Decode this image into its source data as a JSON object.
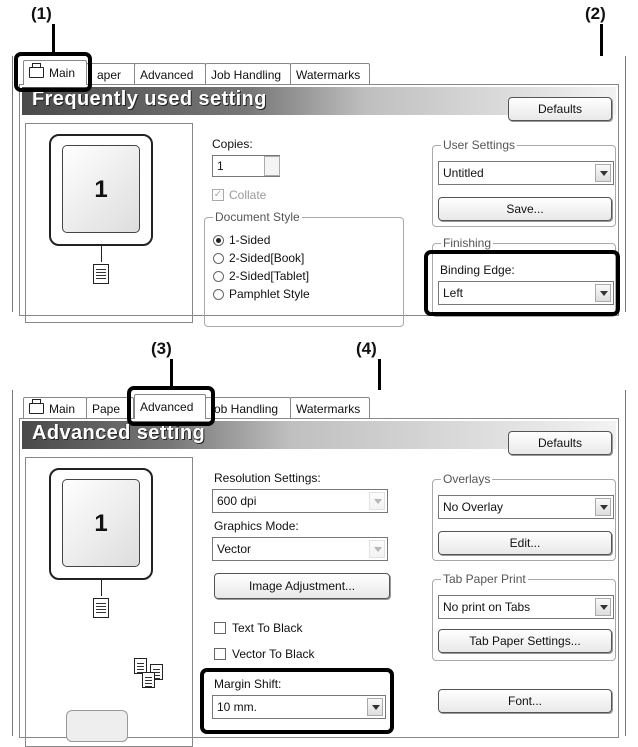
{
  "callouts": {
    "c1": "(1)",
    "c2": "(2)",
    "c3": "(3)",
    "c4": "(4)"
  },
  "tabs": [
    "Main",
    "Paper",
    "Advanced",
    "Job Handling",
    "Watermarks"
  ],
  "tabs_top_shown": {
    "main": "Main",
    "paper": "aper",
    "advanced": "Advanced",
    "job": "Job Handling",
    "watermarks": "Watermarks"
  },
  "tabs_bottom_shown": {
    "main": "Main",
    "paper": "Pape",
    "advanced": "Advanced",
    "job": "ob Handling",
    "watermarks": "Watermarks"
  },
  "top": {
    "banner_title": "Frequently used setting",
    "defaults_button": "Defaults",
    "preview_page_number": "1",
    "copies_label": "Copies:",
    "copies_value": "1",
    "collate_label": "Collate",
    "document_style_group": "Document Style",
    "document_style_options": [
      "1-Sided",
      "2-Sided[Book]",
      "2-Sided[Tablet]",
      "Pamphlet Style"
    ],
    "document_style_selected": "1-Sided",
    "user_settings_group": "User Settings",
    "user_settings_value": "Untitled",
    "save_button": "Save...",
    "finishing_group": "Finishing",
    "binding_edge_label": "Binding Edge:",
    "binding_edge_value": "Left"
  },
  "bottom": {
    "banner_title": "Advanced setting",
    "defaults_button": "Defaults",
    "preview_page_number": "1",
    "resolution_label": "Resolution Settings:",
    "resolution_value": "600 dpi",
    "graphics_mode_label": "Graphics Mode:",
    "graphics_mode_value": "Vector",
    "image_adjustment_button": "Image Adjustment...",
    "text_to_black_label": "Text To Black",
    "vector_to_black_label": "Vector To Black",
    "margin_shift_label": "Margin Shift:",
    "margin_shift_value": "10 mm.",
    "overlays_group": "Overlays",
    "overlays_value": "No Overlay",
    "edit_button": "Edit...",
    "tab_paper_print_group": "Tab Paper Print",
    "tab_paper_print_value": "No print on Tabs",
    "tab_paper_settings_button": "Tab Paper Settings...",
    "font_button": "Font..."
  }
}
